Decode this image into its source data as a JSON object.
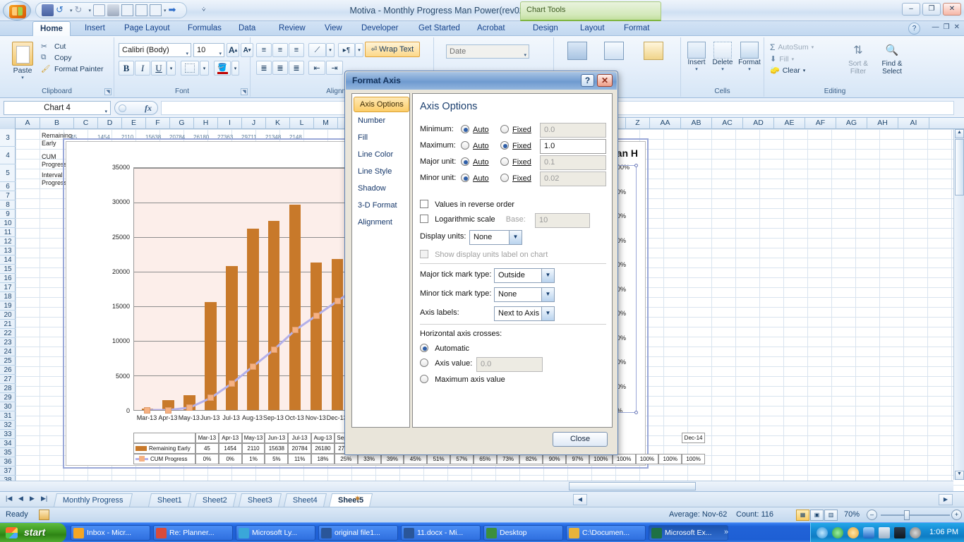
{
  "window": {
    "title": "Motiva - Monthly Progress  Man Power(rev02l).xlsx - Microsoft Excel",
    "contextual_tab_group": "Chart Tools",
    "minimize": "–",
    "restore": "❐",
    "close": "✕"
  },
  "quick_access": {
    "icons": [
      "save-icon",
      "undo-icon",
      "redo-icon",
      "print-preview-icon",
      "print-icon",
      "form-icon",
      "table-icon",
      "list-icon",
      "arrow-icon"
    ]
  },
  "ribbon": {
    "tabs": [
      {
        "label": "Home",
        "active": true
      },
      {
        "label": "Insert",
        "active": false
      },
      {
        "label": "Page Layout",
        "active": false
      },
      {
        "label": "Formulas",
        "active": false
      },
      {
        "label": "Data",
        "active": false
      },
      {
        "label": "Review",
        "active": false
      },
      {
        "label": "View",
        "active": false
      },
      {
        "label": "Developer",
        "active": false
      },
      {
        "label": "Get Started",
        "active": false
      },
      {
        "label": "Acrobat",
        "active": false
      },
      {
        "label": "Design",
        "active": false
      },
      {
        "label": "Layout",
        "active": false
      },
      {
        "label": "Format",
        "active": false
      }
    ],
    "help_label": "?",
    "clipboard": {
      "group_label": "Clipboard",
      "paste": "Paste",
      "cut": "Cut",
      "copy": "Copy",
      "format_painter": "Format Painter"
    },
    "font": {
      "group_label": "Font",
      "family": "Calibri (Body)",
      "size": "10",
      "grow": "A",
      "shrink": "A",
      "bold": "B",
      "italic": "I",
      "underline": "U",
      "borders": "▦",
      "fill_color": "A",
      "font_color": "A"
    },
    "alignment": {
      "group_label": "Alignment",
      "wrap_text": "Wrap Text"
    },
    "number": {
      "group_label": "Number",
      "format": "Date"
    },
    "cells": {
      "group_label": "Cells",
      "insert": "Insert",
      "delete": "Delete",
      "format": "Format"
    },
    "editing": {
      "group_label": "Editing",
      "autosum": "AutoSum",
      "fill": "Fill",
      "clear": "Clear",
      "sort_filter": "Sort &\nFilter",
      "sort_filter_l1": "Sort &",
      "sort_filter_l2": "Filter",
      "find_select_l1": "Find &",
      "find_select_l2": "Select"
    }
  },
  "formula_bar": {
    "name_box": "Chart 4",
    "formula": "",
    "fx_label": "fx"
  },
  "grid": {
    "column_headers": [
      "A",
      "B",
      "C",
      "D",
      "E",
      "F",
      "G",
      "H",
      "I",
      "J",
      "K",
      "L",
      "M",
      "N",
      "O",
      "P",
      "Q",
      "R",
      "S",
      "T",
      "U",
      "V",
      "W",
      "X",
      "Y",
      "Z",
      "AA",
      "AB",
      "AC",
      "AD",
      "AE",
      "AF",
      "AG",
      "AH",
      "AI"
    ],
    "row_headers": [
      "3",
      "4",
      "5",
      "6",
      "7",
      "8",
      "9",
      "10",
      "11",
      "12",
      "13",
      "14",
      "15",
      "16",
      "17",
      "18",
      "19",
      "20",
      "21",
      "22",
      "23",
      "24",
      "25",
      "26",
      "27",
      "28",
      "29",
      "30",
      "31",
      "32",
      "33",
      "34",
      "35",
      "36",
      "37",
      "38",
      "39",
      "40",
      "41"
    ],
    "cells": [
      {
        "ref": "B3",
        "line1": "Remaining",
        "line2": "Early"
      },
      {
        "ref": "B4",
        "line1": "CUM",
        "line2": "Progress"
      },
      {
        "ref": "B5",
        "line1": "Interval",
        "line2": "Progress"
      }
    ],
    "row3_values": [
      "45",
      "1454",
      "2110",
      "15638",
      "20784",
      "26180",
      "27363",
      "29711",
      "21348",
      "2148"
    ]
  },
  "chart": {
    "title": "Man H",
    "name": "Chart 4"
  },
  "chart_data": {
    "type": "bar",
    "title": "Man H",
    "categories": [
      "Mar-13",
      "Apr-13",
      "May-13",
      "Jun-13",
      "Jul-13",
      "Aug-13",
      "Sep-13",
      "Oct-13",
      "Nov-13",
      "Dec-13"
    ],
    "table_headers": [
      "Mar-13",
      "Apr-13",
      "May-13",
      "Jun-13",
      "Jul-13",
      "Aug-13",
      "Sep-13",
      "Oct-13",
      "Nov-13"
    ],
    "series": [
      {
        "name": "Remaining Early",
        "type": "bar",
        "color": "#c8792a",
        "values": [
          45,
          1454,
          2110,
          15638,
          20784,
          26180,
          27363,
          29711,
          21348
        ],
        "table_values": [
          "45",
          "1454",
          "2110",
          "15638",
          "20784",
          "26180",
          "27363",
          "29711",
          "21348"
        ]
      },
      {
        "name": "CUM Progress",
        "type": "line",
        "color": "#b3b0ea",
        "marker_color": "#f5b183",
        "axis": "secondary",
        "values": [
          0,
          0,
          1,
          5,
          11,
          18,
          25,
          33,
          39,
          45,
          51,
          57,
          65,
          73,
          82,
          90,
          97,
          100,
          100,
          100,
          100,
          100
        ],
        "table_values": [
          "0%",
          "0%",
          "1%",
          "5%",
          "11%",
          "18%",
          "25%",
          "33%",
          "39%",
          "45%",
          "51%",
          "57%",
          "65%",
          "73%",
          "82%",
          "90%",
          "97%",
          "100%",
          "100%",
          "100%",
          "100%",
          "100%"
        ]
      }
    ],
    "y_axis_primary": {
      "label": "",
      "ticks": [
        "0",
        "5000",
        "10000",
        "15000",
        "20000",
        "25000",
        "30000",
        "35000"
      ],
      "min": 0,
      "max": 35000,
      "major_unit": 5000
    },
    "y_axis_secondary": {
      "label": "",
      "ticks": [
        "0%",
        "10%",
        "20%",
        "30%",
        "40%",
        "50%",
        "60%",
        "70%",
        "80%",
        "90%",
        "100%"
      ],
      "min": 0,
      "max": 1,
      "major_unit": 0.1
    },
    "x_tick_extra": [
      "Dec-14"
    ],
    "grid": true,
    "legend_position": "data-table"
  },
  "dialog": {
    "title": "Format Axis",
    "help_btn": "?",
    "close_btn": "✕",
    "nav_items": [
      {
        "label": "Axis Options",
        "selected": true
      },
      {
        "label": "Number",
        "selected": false
      },
      {
        "label": "Fill",
        "selected": false
      },
      {
        "label": "Line Color",
        "selected": false
      },
      {
        "label": "Line Style",
        "selected": false
      },
      {
        "label": "Shadow",
        "selected": false
      },
      {
        "label": "3-D Format",
        "selected": false
      },
      {
        "label": "Alignment",
        "selected": false
      }
    ],
    "panel_heading": "Axis Options",
    "rows": [
      {
        "label": "Minimum:",
        "auto": "Auto",
        "fixed": "Fixed",
        "selected": "auto",
        "value": "0.0",
        "value_disabled": true
      },
      {
        "label": "Maximum:",
        "auto": "Auto",
        "fixed": "Fixed",
        "selected": "fixed",
        "value": "1.0",
        "value_disabled": false
      },
      {
        "label": "Major unit:",
        "auto": "Auto",
        "fixed": "Fixed",
        "selected": "auto",
        "value": "0.1",
        "value_disabled": true
      },
      {
        "label": "Minor unit:",
        "auto": "Auto",
        "fixed": "Fixed",
        "selected": "auto",
        "value": "0.02",
        "value_disabled": true
      }
    ],
    "reverse_order": {
      "label": "Values in reverse order",
      "checked": false
    },
    "log_scale": {
      "label": "Logarithmic scale",
      "checked": false,
      "base_label": "Base:",
      "base_value": "10",
      "base_disabled": true
    },
    "display_units": {
      "label": "Display units:",
      "value": "None"
    },
    "show_units_label": {
      "label": "Show display units label on chart",
      "checked": false,
      "disabled": true
    },
    "major_tick": {
      "label": "Major tick mark type:",
      "value": "Outside"
    },
    "minor_tick": {
      "label": "Minor tick mark type:",
      "value": "None"
    },
    "axis_labels": {
      "label": "Axis labels:",
      "value": "Next to Axis"
    },
    "crosses": {
      "heading": "Horizontal axis crosses:",
      "options": [
        {
          "label": "Automatic",
          "selected": true
        },
        {
          "label": "Axis value:",
          "selected": false,
          "value": "0.0",
          "value_disabled": true
        },
        {
          "label": "Maximum axis value",
          "selected": false
        }
      ]
    },
    "close_label": "Close"
  },
  "sheet_tabs": {
    "nav": [
      "|◀",
      "◀",
      "▶",
      "▶|"
    ],
    "tabs": [
      {
        "label": "Monthly Progress",
        "active": false
      },
      {
        "label": "Sheet1",
        "active": false
      },
      {
        "label": "Sheet2",
        "active": false
      },
      {
        "label": "Sheet3",
        "active": false
      },
      {
        "label": "Sheet4",
        "active": false
      },
      {
        "label": "Sheet5",
        "active": true
      }
    ],
    "insert_sheet": "✷"
  },
  "status_bar": {
    "mode": "Ready",
    "average": "Average: Nov-62",
    "count": "Count: 116",
    "zoom": "70%",
    "view_buttons": [
      "normal-view",
      "page-layout-view",
      "page-break-view"
    ]
  },
  "taskbar": {
    "start": "start",
    "items": [
      {
        "label": "Inbox - Micr...",
        "icon_color": "#f5a623",
        "active": false
      },
      {
        "label": "Re: Planner...",
        "icon_color": "#d94b3a",
        "active": false
      },
      {
        "label": "Microsoft Ly...",
        "icon_color": "#3aa7d9",
        "active": false
      },
      {
        "label": "original file1...",
        "icon_color": "#2a5699",
        "active": false
      },
      {
        "label": "11.docx - Mi...",
        "icon_color": "#2a5699",
        "active": false
      },
      {
        "label": "Desktop",
        "icon_color": "#3c8f3c",
        "active": false
      },
      {
        "label": "C:\\Documen...",
        "icon_color": "#e8b33a",
        "active": false
      },
      {
        "label": "Microsoft Ex...",
        "icon_color": "#1e7145",
        "active": true
      }
    ],
    "tray_expand": "»",
    "clock": "1:06 PM"
  }
}
